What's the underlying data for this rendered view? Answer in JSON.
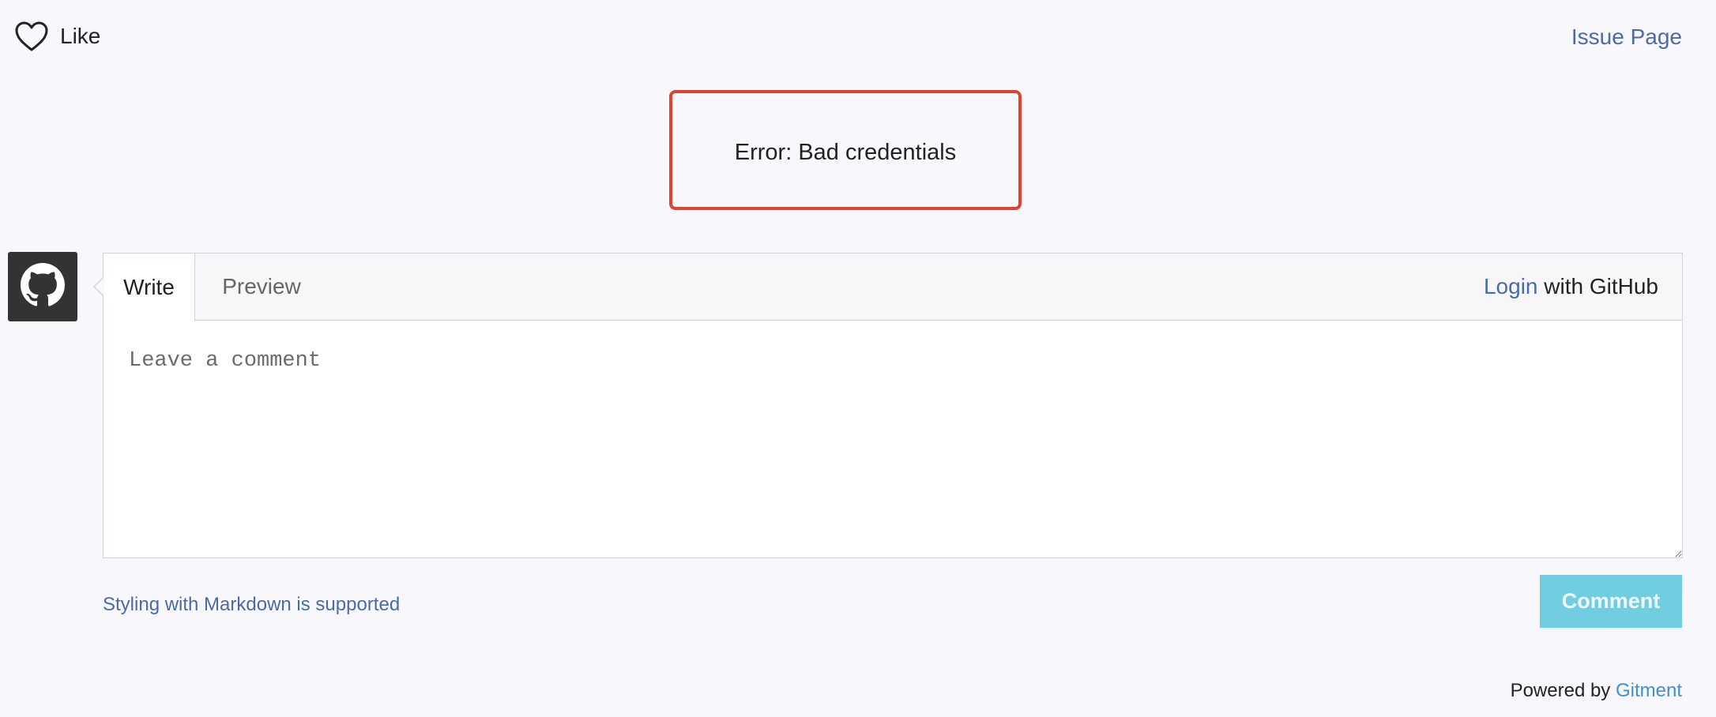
{
  "like": {
    "label": "Like",
    "icon": "heart-outline-icon"
  },
  "issue_page": {
    "label": "Issue Page"
  },
  "error": {
    "message": "Error: Bad credentials",
    "border_color": "#e0432f"
  },
  "avatar": {
    "icon": "github-icon"
  },
  "editor": {
    "tabs": [
      {
        "label": "Write",
        "active": true
      },
      {
        "label": "Preview",
        "active": false
      }
    ],
    "login_link": "Login",
    "login_suffix": " with GitHub",
    "placeholder": "Leave a comment",
    "value": ""
  },
  "footer": {
    "markdown_hint": "Styling with Markdown is supported",
    "comment_button": "Comment",
    "powered_prefix": "Powered by ",
    "powered_link": "Gitment"
  },
  "colors": {
    "background": "#f8f8fc",
    "link": "#4b6aa6",
    "button": "#71cde0",
    "gitment_link": "#3d8fd8"
  }
}
